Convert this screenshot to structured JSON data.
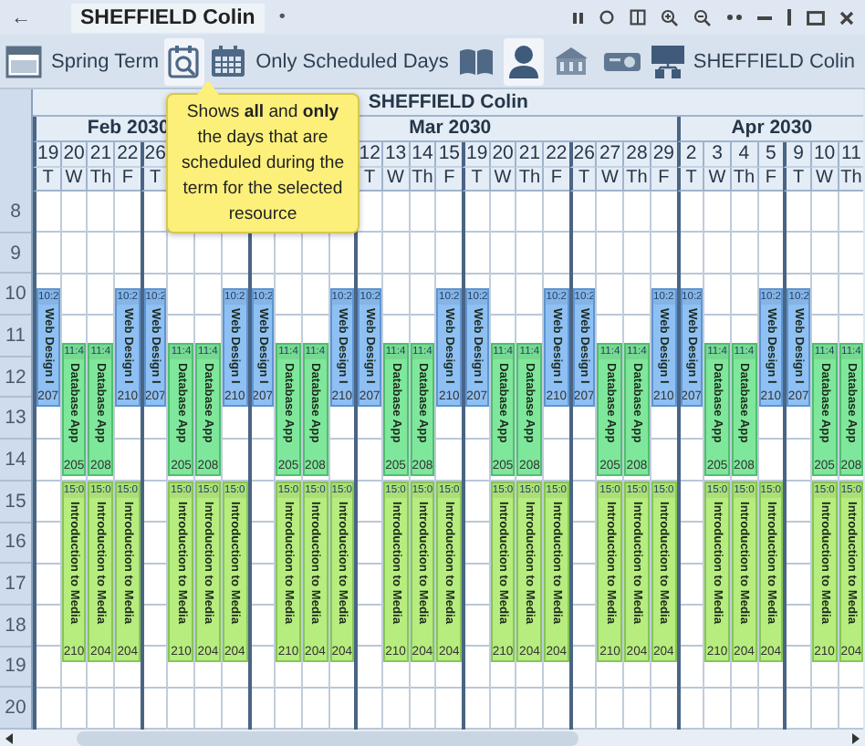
{
  "title_bar": {
    "back": "←",
    "tab": "SHEFFIELD Colin",
    "tab_dot": "•"
  },
  "toolbar": [
    {
      "kind": "term",
      "label": "Spring Term"
    },
    {
      "kind": "zoom_days",
      "selected": true
    },
    {
      "kind": "days_filter",
      "label": "Only Scheduled Days"
    },
    {
      "kind": "books",
      "selected": false
    },
    {
      "kind": "person",
      "selected": true
    },
    {
      "kind": "building",
      "selected": false
    },
    {
      "kind": "projector",
      "selected": false
    },
    {
      "kind": "org",
      "label": "SHEFFIELD Colin"
    }
  ],
  "tooltip": "Shows **all** and **only** the days that are scheduled during the term for the selected resource",
  "calendar": {
    "resource": "SHEFFIELD Colin",
    "hours": [
      "8",
      "9",
      "10",
      "11",
      "12",
      "13",
      "14",
      "15",
      "16",
      "17",
      "18",
      "19",
      "20"
    ],
    "months": [
      {
        "label": "Feb 2030",
        "days": [
          {
            "day": "19",
            "weekday": "T",
            "week_start": true,
            "events": [
              {
                "kind": "web",
                "time": "10:2",
                "title": "Web Design I",
                "room": "207"
              }
            ]
          },
          {
            "day": "20",
            "weekday": "W",
            "week_start": false,
            "events": [
              {
                "kind": "db",
                "time": "11:4",
                "title": "Database App",
                "room": "205"
              },
              {
                "kind": "intro",
                "time": "15:0",
                "title": "Introduction to Media",
                "room": "210"
              }
            ]
          },
          {
            "day": "21",
            "weekday": "Th",
            "week_start": false,
            "events": [
              {
                "kind": "db",
                "time": "11:4",
                "title": "Database App",
                "room": "208"
              },
              {
                "kind": "intro",
                "time": "15:0",
                "title": "Introduction to Media",
                "room": "204"
              }
            ]
          },
          {
            "day": "22",
            "weekday": "F",
            "week_start": false,
            "events": [
              {
                "kind": "web",
                "time": "10:2",
                "title": "Web Design I",
                "room": "210"
              },
              {
                "kind": "intro",
                "time": "15:0",
                "title": "Introduction to Media",
                "room": "204"
              }
            ]
          },
          {
            "day": "26",
            "weekday": "T",
            "week_start": true,
            "events": [
              {
                "kind": "web",
                "time": "10:2",
                "title": "Web Design I",
                "room": "207"
              }
            ]
          },
          {
            "week_start": false,
            "events": [
              {
                "kind": "db",
                "time": "11:4",
                "title": "Database App",
                "room": "205"
              },
              {
                "kind": "intro",
                "time": "15:0",
                "title": "Introduction to Media",
                "room": "210"
              }
            ]
          },
          {
            "week_start": false,
            "events": [
              {
                "kind": "db",
                "time": "11:4",
                "title": "Database App",
                "room": "208"
              },
              {
                "kind": "intro",
                "time": "15:0",
                "title": "Introduction to Media",
                "room": "204"
              }
            ]
          }
        ]
      },
      {
        "label": "Mar 2030",
        "days": [
          {
            "week_start": false,
            "events": [
              {
                "kind": "web",
                "time": "10:2",
                "title": "Web Design I",
                "room": "210"
              },
              {
                "kind": "intro",
                "time": "15:0",
                "title": "Introduction to Media",
                "room": "204"
              }
            ]
          },
          {
            "week_start": true,
            "events": [
              {
                "kind": "web",
                "time": "10:2",
                "title": "Web Design I",
                "room": "207"
              }
            ]
          },
          {
            "week_start": false,
            "events": [
              {
                "kind": "db",
                "time": "11:4",
                "title": "Database App",
                "room": "205"
              },
              {
                "kind": "intro",
                "time": "15:0",
                "title": "Introduction to Media",
                "room": "210"
              }
            ]
          },
          {
            "week_start": false,
            "events": [
              {
                "kind": "db",
                "time": "11:4",
                "title": "Database App",
                "room": "208"
              },
              {
                "kind": "intro",
                "time": "15:0",
                "title": "Introduction to Media",
                "room": "204"
              }
            ]
          },
          {
            "week_start": false,
            "events": [
              {
                "kind": "web",
                "time": "10:2",
                "title": "Web Design I",
                "room": "210"
              },
              {
                "kind": "intro",
                "time": "15:0",
                "title": "Introduction to Media",
                "room": "204"
              }
            ]
          },
          {
            "day": "12",
            "weekday": "T",
            "week_start": true,
            "events": [
              {
                "kind": "web",
                "time": "10:2",
                "title": "Web Design I",
                "room": "207"
              }
            ]
          },
          {
            "day": "13",
            "weekday": "W",
            "week_start": false,
            "events": [
              {
                "kind": "db",
                "time": "11:4",
                "title": "Database App",
                "room": "205"
              },
              {
                "kind": "intro",
                "time": "15:0",
                "title": "Introduction to Media",
                "room": "210"
              }
            ]
          },
          {
            "day": "14",
            "weekday": "Th",
            "week_start": false,
            "events": [
              {
                "kind": "db",
                "time": "11:4",
                "title": "Database App",
                "room": "208"
              },
              {
                "kind": "intro",
                "time": "15:0",
                "title": "Introduction to Media",
                "room": "204"
              }
            ]
          },
          {
            "day": "15",
            "weekday": "F",
            "week_start": false,
            "events": [
              {
                "kind": "web",
                "time": "10:2",
                "title": "Web Design I",
                "room": "210"
              },
              {
                "kind": "intro",
                "time": "15:0",
                "title": "Introduction to Media",
                "room": "204"
              }
            ]
          },
          {
            "day": "19",
            "weekday": "T",
            "week_start": true,
            "events": [
              {
                "kind": "web",
                "time": "10:2",
                "title": "Web Design I",
                "room": "207"
              }
            ]
          },
          {
            "day": "20",
            "weekday": "W",
            "week_start": false,
            "events": [
              {
                "kind": "db",
                "time": "11:4",
                "title": "Database App",
                "room": "205"
              },
              {
                "kind": "intro",
                "time": "15:0",
                "title": "Introduction to Media",
                "room": "210"
              }
            ]
          },
          {
            "day": "21",
            "weekday": "Th",
            "week_start": false,
            "events": [
              {
                "kind": "db",
                "time": "11:4",
                "title": "Database App",
                "room": "208"
              },
              {
                "kind": "intro",
                "time": "15:0",
                "title": "Introduction to Media",
                "room": "204"
              }
            ]
          },
          {
            "day": "22",
            "weekday": "F",
            "week_start": false,
            "events": [
              {
                "kind": "web",
                "time": "10:2",
                "title": "Web Design I",
                "room": "210"
              },
              {
                "kind": "intro",
                "time": "15:0",
                "title": "Introduction to Media",
                "room": "204"
              }
            ]
          },
          {
            "day": "26",
            "weekday": "T",
            "week_start": true,
            "events": [
              {
                "kind": "web",
                "time": "10:2",
                "title": "Web Design I",
                "room": "207"
              }
            ]
          },
          {
            "day": "27",
            "weekday": "W",
            "week_start": false,
            "events": [
              {
                "kind": "db",
                "time": "11:4",
                "title": "Database App",
                "room": "205"
              },
              {
                "kind": "intro",
                "time": "15:0",
                "title": "Introduction to Media",
                "room": "210"
              }
            ]
          },
          {
            "day": "28",
            "weekday": "Th",
            "week_start": false,
            "events": [
              {
                "kind": "db",
                "time": "11:4",
                "title": "Database App",
                "room": "208"
              },
              {
                "kind": "intro",
                "time": "15:0",
                "title": "Introduction to Media",
                "room": "204"
              }
            ]
          },
          {
            "day": "29",
            "weekday": "F",
            "week_start": false,
            "events": [
              {
                "kind": "web",
                "time": "10:2",
                "title": "Web Design I",
                "room": "210"
              },
              {
                "kind": "intro",
                "time": "15:0",
                "title": "Introduction to Media",
                "room": "204"
              }
            ]
          }
        ]
      },
      {
        "label": "Apr 2030",
        "days": [
          {
            "day": "2",
            "weekday": "T",
            "week_start": true,
            "events": [
              {
                "kind": "web",
                "time": "10:2",
                "title": "Web Design I",
                "room": "207"
              }
            ]
          },
          {
            "day": "3",
            "weekday": "W",
            "week_start": false,
            "events": [
              {
                "kind": "db",
                "time": "11:4",
                "title": "Database App",
                "room": "205"
              },
              {
                "kind": "intro",
                "time": "15:0",
                "title": "Introduction to Media",
                "room": "210"
              }
            ]
          },
          {
            "day": "4",
            "weekday": "Th",
            "week_start": false,
            "events": [
              {
                "kind": "db",
                "time": "11:4",
                "title": "Database App",
                "room": "208"
              },
              {
                "kind": "intro",
                "time": "15:0",
                "title": "Introduction to Media",
                "room": "204"
              }
            ]
          },
          {
            "day": "5",
            "weekday": "F",
            "week_start": false,
            "events": [
              {
                "kind": "web",
                "time": "10:2",
                "title": "Web Design I",
                "room": "210"
              },
              {
                "kind": "intro",
                "time": "15:0",
                "title": "Introduction to Media",
                "room": "204"
              }
            ]
          },
          {
            "day": "9",
            "weekday": "T",
            "week_start": true,
            "events": [
              {
                "kind": "web",
                "time": "10:2",
                "title": "Web Design I",
                "room": "207"
              }
            ]
          },
          {
            "day": "10",
            "weekday": "W",
            "week_start": false,
            "events": [
              {
                "kind": "db",
                "time": "11:4",
                "title": "Database App",
                "room": "205"
              },
              {
                "kind": "intro",
                "time": "15:0",
                "title": "Introduction to Media",
                "room": "210"
              }
            ]
          },
          {
            "day": "11",
            "weekday": "Th",
            "week_start": false,
            "events": [
              {
                "kind": "db",
                "time": "11:4",
                "title": "Database App",
                "room": "208"
              },
              {
                "kind": "intro",
                "time": "15:0",
                "title": "Introduction to Media",
                "room": "204"
              }
            ]
          }
        ]
      }
    ]
  }
}
